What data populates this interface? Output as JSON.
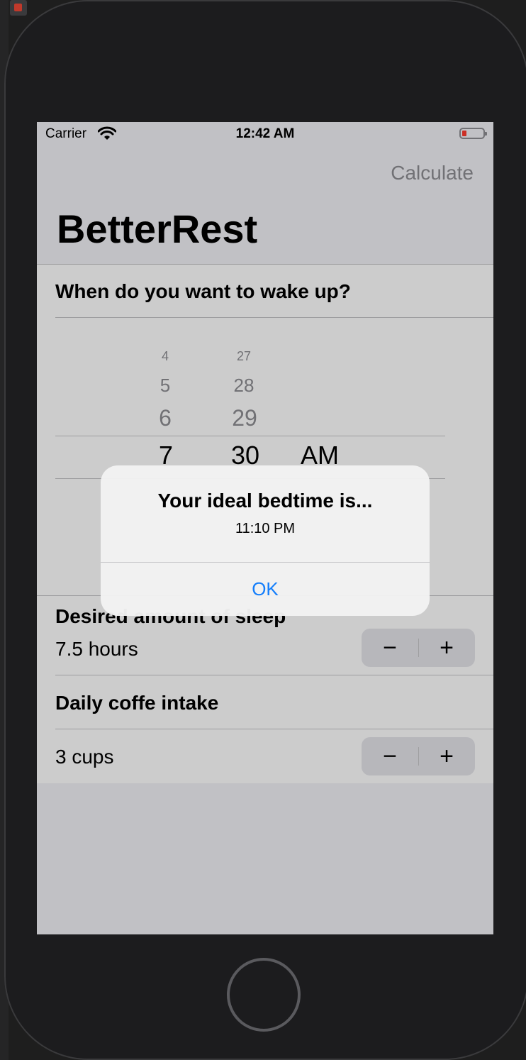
{
  "status_bar": {
    "carrier": "Carrier",
    "time": "12:42 AM"
  },
  "nav": {
    "calculate_label": "Calculate",
    "title": "BetterRest"
  },
  "wake": {
    "header": "When do you want to wake up?",
    "hours": [
      "4",
      "5",
      "6",
      "7"
    ],
    "minutes": [
      "27",
      "28",
      "29",
      "30"
    ],
    "period": "AM"
  },
  "sleep": {
    "header": "Desired amount of sleep",
    "value": "7.5 hours"
  },
  "coffee": {
    "header": "Daily coffe intake",
    "value": "3 cups"
  },
  "stepper": {
    "minus": "−",
    "plus": "+"
  },
  "alert": {
    "title": "Your ideal bedtime is...",
    "message": "11:10 PM",
    "ok_label": "OK"
  },
  "colors": {
    "accent": "#147efb",
    "background": "#f2f2f7",
    "battery_low": "#ff3b30"
  }
}
